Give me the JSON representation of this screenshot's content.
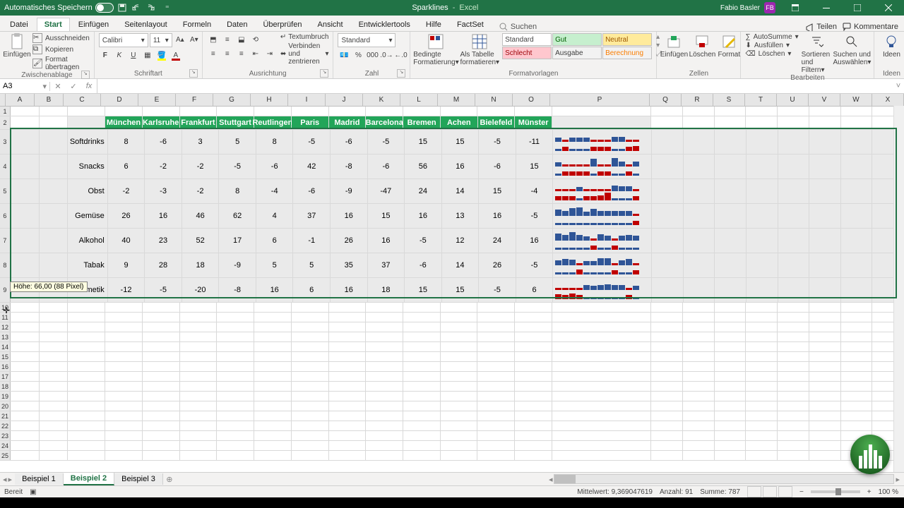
{
  "titlebar": {
    "autosave_label": "Automatisches Speichern",
    "doc_name": "Sparklines",
    "app_name": "Excel",
    "user_name": "Fabio Basler",
    "user_initials": "FB"
  },
  "tabs": {
    "items": [
      "Datei",
      "Start",
      "Einfügen",
      "Seitenlayout",
      "Formeln",
      "Daten",
      "Überprüfen",
      "Ansicht",
      "Entwicklertools",
      "Hilfe",
      "FactSet"
    ],
    "active": "Start",
    "search_placeholder": "Suchen",
    "share": "Teilen",
    "comments": "Kommentare"
  },
  "ribbon": {
    "clipboard": {
      "label": "Zwischenablage",
      "paste": "Einfügen",
      "cut": "Ausschneiden",
      "copy": "Kopieren",
      "format_painter": "Format übertragen"
    },
    "font": {
      "label": "Schriftart",
      "name": "Calibri",
      "size": "11"
    },
    "alignment": {
      "label": "Ausrichtung",
      "wrap": "Textumbruch",
      "merge": "Verbinden und zentrieren"
    },
    "number": {
      "label": "Zahl",
      "format": "Standard"
    },
    "styles": {
      "label": "Formatvorlagen",
      "cond": "Bedingte",
      "cond2": "Formatierung",
      "astable": "Als Tabelle",
      "astable2": "formatieren",
      "cells_std": "Standard",
      "cells_gut": "Gut",
      "cells_neutral": "Neutral",
      "cells_schl": "Schlecht",
      "cells_ausg": "Ausgabe",
      "cells_ber": "Berechnung"
    },
    "cells": {
      "label": "Zellen",
      "insert": "Einfügen",
      "delete": "Löschen",
      "format": "Format"
    },
    "editing": {
      "label": "Bearbeiten",
      "autosum": "AutoSumme",
      "fill": "Ausfüllen",
      "clear": "Löschen",
      "sort": "Sortieren und",
      "sort2": "Filtern",
      "find": "Suchen und",
      "find2": "Auswählen"
    },
    "ideas": {
      "label": "Ideen",
      "btn": "Ideen"
    }
  },
  "namebox": {
    "ref": "A3"
  },
  "columns": [
    "A",
    "B",
    "C",
    "D",
    "E",
    "F",
    "G",
    "H",
    "I",
    "J",
    "K",
    "L",
    "M",
    "N",
    "O",
    "P",
    "Q",
    "R",
    "S",
    "T",
    "U",
    "V",
    "W",
    "X"
  ],
  "header_row": [
    "München",
    "Karlsruhe",
    "Frankfurt",
    "Stuttgart",
    "Reutlingen",
    "Paris",
    "Madrid",
    "Barcelona",
    "Bremen",
    "Achen",
    "Bielefeld",
    "Münster"
  ],
  "row_labels": [
    "Softdrinks",
    "Snacks",
    "Obst",
    "Gemüse",
    "Alkohol",
    "Tabak",
    "Kosmetik"
  ],
  "chart_data": {
    "type": "table",
    "categories": [
      "München",
      "Karlsruhe",
      "Frankfurt",
      "Stuttgart",
      "Reutlingen",
      "Paris",
      "Madrid",
      "Barcelona",
      "Bremen",
      "Achen",
      "Bielefeld",
      "Münster"
    ],
    "series": [
      {
        "name": "Softdrinks",
        "values": [
          8,
          -6,
          3,
          5,
          8,
          -5,
          -6,
          -5,
          15,
          15,
          -5,
          -11
        ]
      },
      {
        "name": "Snacks",
        "values": [
          6,
          -2,
          -2,
          -5,
          -6,
          42,
          -8,
          -6,
          56,
          16,
          -6,
          15
        ]
      },
      {
        "name": "Obst",
        "values": [
          -2,
          -3,
          -2,
          8,
          -4,
          -6,
          -9,
          -47,
          24,
          14,
          15,
          -4
        ]
      },
      {
        "name": "Gemüse",
        "values": [
          26,
          16,
          46,
          62,
          4,
          37,
          16,
          15,
          16,
          13,
          16,
          -5
        ]
      },
      {
        "name": "Alkohol",
        "values": [
          40,
          23,
          52,
          17,
          6,
          -1,
          26,
          16,
          -5,
          12,
          24,
          16
        ]
      },
      {
        "name": "Tabak",
        "values": [
          9,
          28,
          18,
          -9,
          5,
          5,
          35,
          37,
          -6,
          14,
          26,
          -5
        ]
      },
      {
        "name": "Kosmetik",
        "values": [
          -12,
          -5,
          -20,
          -8,
          16,
          6,
          16,
          18,
          15,
          15,
          -5,
          6
        ]
      }
    ]
  },
  "row_resize": {
    "tooltip": "Höhe: 66,00 (88 Pixel)"
  },
  "sheets": {
    "tabs": [
      "Beispiel 1",
      "Beispiel 2",
      "Beispiel 3"
    ],
    "active": "Beispiel 2"
  },
  "status": {
    "ready": "Bereit",
    "avg_label": "Mittelwert:",
    "avg_value": "9,369047619",
    "count_label": "Anzahl:",
    "count_value": "91",
    "sum_label": "Summe:",
    "sum_value": "787",
    "zoom": "100 %"
  }
}
